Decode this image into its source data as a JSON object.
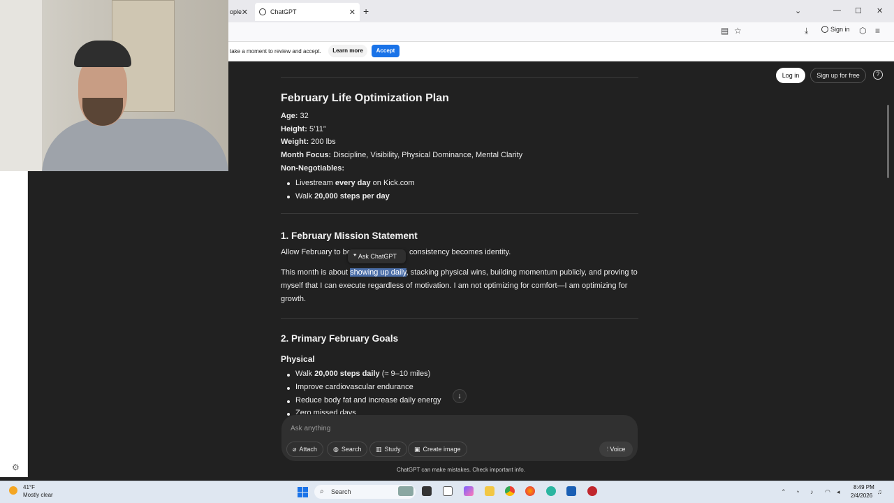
{
  "browser": {
    "tabs": [
      {
        "label": "ople",
        "active": false
      },
      {
        "label": "ChatGPT",
        "active": true
      }
    ],
    "new_tab": "+",
    "close_glyph": "✕",
    "window_controls": [
      "—",
      "☐",
      "✕"
    ],
    "signin_label": "Sign in",
    "cookie_text": "take a moment to review and accept.",
    "learn_more": "Learn more",
    "accept": "Accept"
  },
  "chatgpt_header": {
    "login": "Log in",
    "signup": "Sign up for free",
    "help": "?"
  },
  "content": {
    "title": "February Life Optimization Plan",
    "age_label": "Age:",
    "age_value": " 32",
    "height_label": "Height:",
    "height_value": " 5’11”",
    "weight_label": "Weight:",
    "weight_value": " 200 lbs",
    "focus_label": "Month Focus:",
    "focus_value": " Discipline, Visibility, Physical Dominance, Mental Clarity",
    "nonneg_label": "Non-Negotiables:",
    "nonneg_1_a": "Livestream ",
    "nonneg_1_b": "every day",
    "nonneg_1_c": " on Kick.com",
    "nonneg_2_a": "Walk ",
    "nonneg_2_b": "20,000 steps per day",
    "section1_title": "1. February Mission Statement",
    "mission_line1_a": "Allow February to be",
    "mission_line1_b": "consistency becomes identity.",
    "mission_p2_a": "This month is about ",
    "mission_p2_highlight": "showing up daily",
    "mission_p2_b": ", stacking physical wins, building momentum publicly, and proving to",
    "mission_p2_line2": "myself that I can execute regardless of motivation. I am not optimizing for comfort—I am optimizing for",
    "mission_p2_line3": "growth.",
    "ask_chatgpt": "Ask ChatGPT",
    "section2_title": "2. Primary February Goals",
    "physical_title": "Physical",
    "phys_1_a": "Walk ",
    "phys_1_b": "20,000 steps daily",
    "phys_1_c": " (≈ 9–10 miles)",
    "phys_2": "Improve cardiovascular endurance",
    "phys_3": "Reduce body fat and increase daily energy",
    "phys_4": "Zero missed days"
  },
  "composer": {
    "placeholder": "Ask anything",
    "attach": "Attach",
    "search": "Search",
    "study": "Study",
    "create_image": "Create image",
    "voice": "Voice",
    "disclaimer": "ChatGPT can make mistakes. Check important info."
  },
  "taskbar": {
    "weather_temp": "41°F",
    "weather_desc": "Mostly clear",
    "search_label": "Search",
    "time": "8:49 PM",
    "date": "2/4/2026"
  }
}
